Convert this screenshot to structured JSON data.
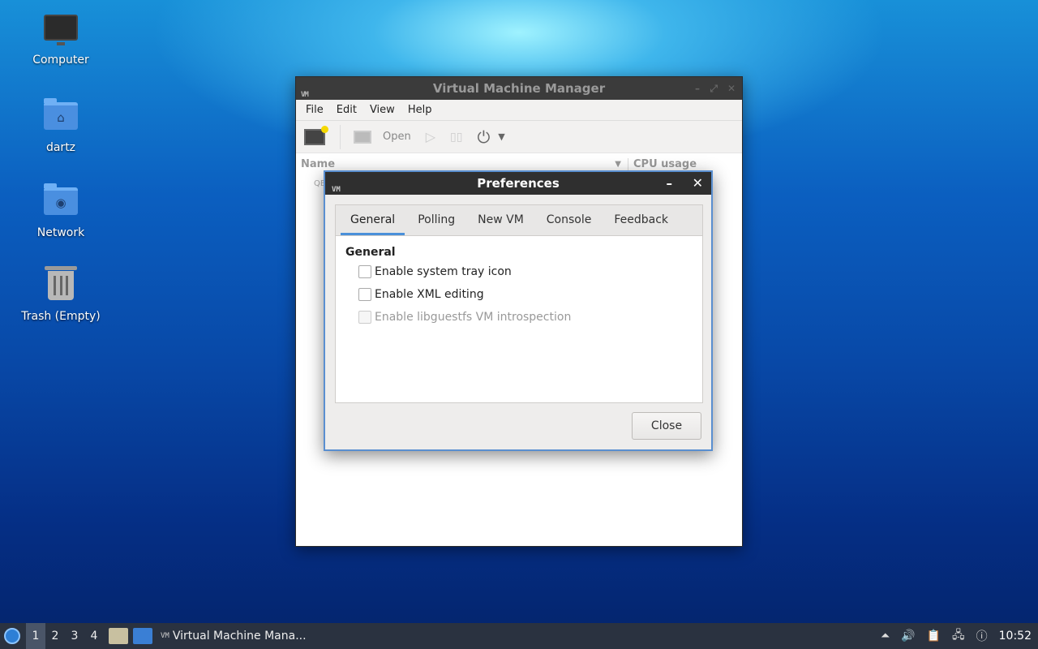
{
  "desktop": {
    "icons": [
      {
        "label": "Computer"
      },
      {
        "label": "dartz"
      },
      {
        "label": "Network"
      },
      {
        "label": "Trash (Empty)"
      }
    ]
  },
  "vmm": {
    "title": "Virtual Machine Manager",
    "app_icon_text": "VM",
    "menu": [
      "File",
      "Edit",
      "View",
      "Help"
    ],
    "toolbar": {
      "open_label": "Open"
    },
    "columns": {
      "name": "Name",
      "cpu": "CPU usage"
    },
    "row_fragment": "QE"
  },
  "preferences": {
    "title": "Preferences",
    "app_icon_text": "VM",
    "tabs": [
      "General",
      "Polling",
      "New VM",
      "Console",
      "Feedback"
    ],
    "active_tab": "General",
    "section_title": "General",
    "options": [
      {
        "label": "Enable system tray icon",
        "checked": false,
        "enabled": true
      },
      {
        "label": "Enable XML editing",
        "checked": false,
        "enabled": true
      },
      {
        "label": "Enable libguestfs VM introspection",
        "checked": false,
        "enabled": false
      }
    ],
    "close_label": "Close"
  },
  "taskbar": {
    "workspaces": [
      "1",
      "2",
      "3",
      "4"
    ],
    "active_workspace": "1",
    "task_label": "Virtual Machine Mana...",
    "task_icon_text": "VM",
    "clock": "10:52"
  }
}
